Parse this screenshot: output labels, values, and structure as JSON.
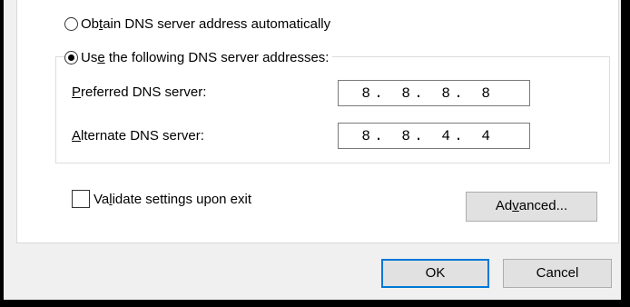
{
  "dns": {
    "auto_option": {
      "before": "Ob",
      "mnemonic": "t",
      "after": "ain DNS server address automatically",
      "checked": false
    },
    "manual_option": {
      "before": "Us",
      "mnemonic": "e",
      "after": " the following DNS server addresses:",
      "checked": true
    },
    "preferred": {
      "label_mnemonic": "P",
      "label_rest": "referred DNS server:",
      "octets": [
        "8",
        "8",
        "8",
        "8"
      ]
    },
    "alternate": {
      "label_mnemonic": "A",
      "label_rest": "lternate DNS server:",
      "octets": [
        "8",
        "8",
        "4",
        "4"
      ]
    },
    "separator": "."
  },
  "validate": {
    "before": "Va",
    "mnemonic": "l",
    "after": "idate settings upon exit",
    "checked": false
  },
  "advanced_button": {
    "before": "Ad",
    "mnemonic": "v",
    "after": "anced..."
  },
  "ok_button": {
    "label": "OK"
  },
  "cancel_button": {
    "label": "Cancel"
  },
  "colors": {
    "dialog_bg": "#f0f0f0",
    "panel_bg": "#ffffff",
    "button_bg": "#e1e1e1",
    "default_button_border": "#0078d7"
  }
}
